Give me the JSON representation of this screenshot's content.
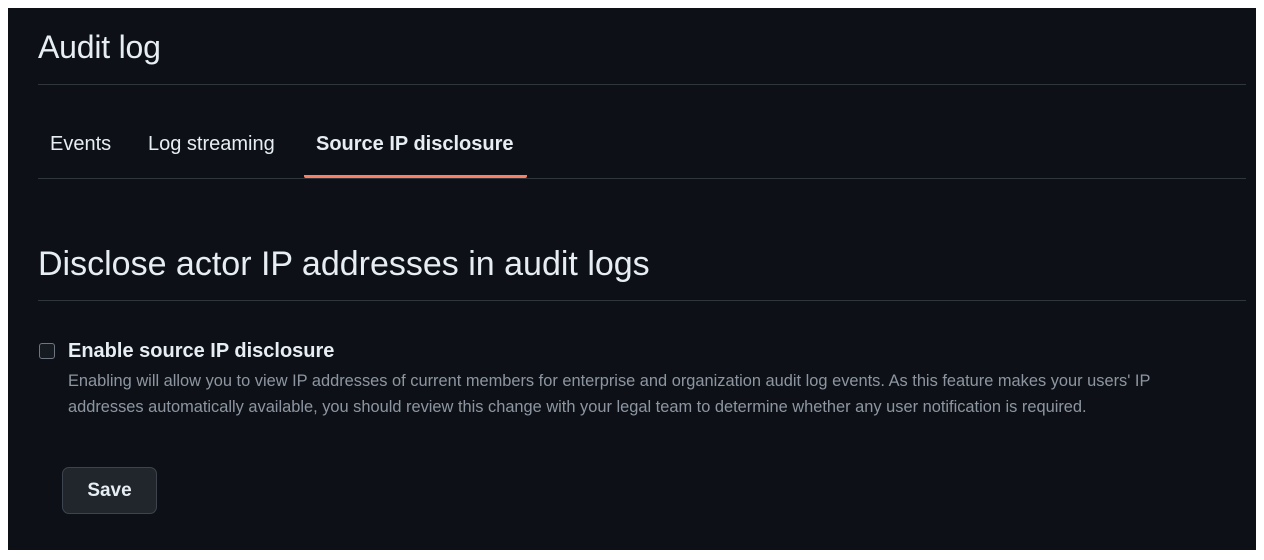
{
  "header": {
    "title": "Audit log"
  },
  "tabs": [
    {
      "label": "Events",
      "selected": false
    },
    {
      "label": "Log streaming",
      "selected": false
    },
    {
      "label": "Source IP disclosure",
      "selected": true
    }
  ],
  "section": {
    "title": "Disclose actor IP addresses in audit logs",
    "checkbox": {
      "label": "Enable source IP disclosure",
      "checked": false,
      "description": "Enabling will allow you to view IP addresses of current members for enterprise and organization audit log events. As this feature makes your users' IP addresses automatically available, you should review this change with your legal team to determine whether any user notification is required."
    },
    "save_label": "Save"
  },
  "colors": {
    "background": "#0d1117",
    "text": "#e6edf3",
    "muted_text": "#8d96a0",
    "border": "#30363d",
    "active_tab_underline": "#f78166",
    "button_bg": "#21262d"
  }
}
